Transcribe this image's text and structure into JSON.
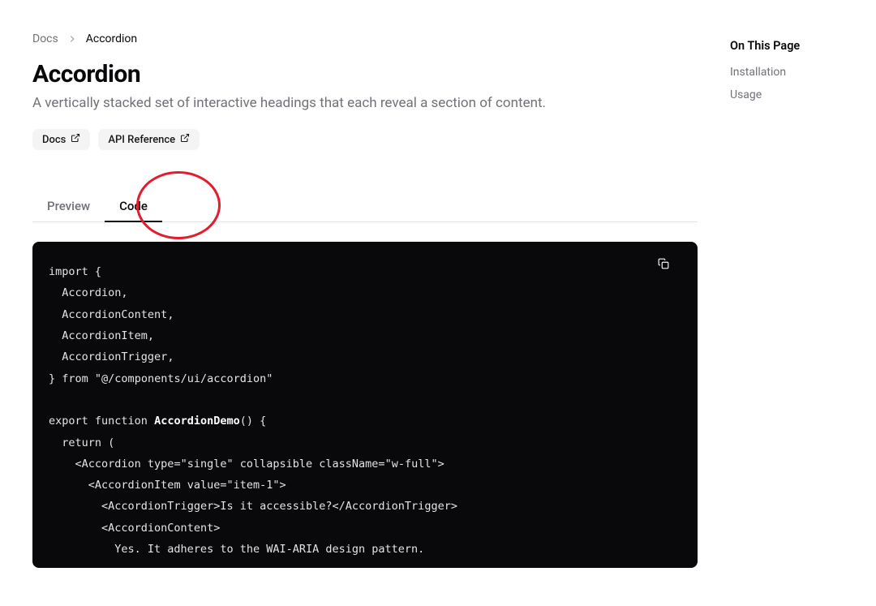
{
  "breadcrumb": {
    "docs": "Docs",
    "current": "Accordion"
  },
  "title": "Accordion",
  "description": "A vertically stacked set of interactive headings that each reveal a section of content.",
  "pills": {
    "docs": "Docs",
    "api": "API Reference"
  },
  "tabs": {
    "preview": "Preview",
    "code": "Code"
  },
  "code": {
    "line1_import": "import",
    "line1_brace": " {",
    "line2": "  Accordion",
    "line2_comma": ",",
    "line3": "  AccordionContent",
    "line3_comma": ",",
    "line4": "  AccordionItem",
    "line4_comma": ",",
    "line5": "  AccordionTrigger",
    "line5_comma": ",",
    "line6_brace": "}",
    "line6_from": " from ",
    "line6_str": "\"@/components/ui/accordion\"",
    "line7": "",
    "line8_export": "export",
    "line8_function": " function ",
    "line8_name": "AccordionDemo",
    "line8_rest": "() {",
    "line9": "  return (",
    "line10_a": "    <",
    "line10_b": "Accordion",
    "line10_c": " type",
    "line10_d": "=",
    "line10_e": "\"single\"",
    "line10_f": " collapsible className",
    "line10_g": "=",
    "line10_h": "\"w-full\"",
    "line10_i": ">",
    "line11_a": "      <",
    "line11_b": "AccordionItem",
    "line11_c": " value",
    "line11_d": "=",
    "line11_e": "\"item-1\"",
    "line11_f": ">",
    "line12_a": "        <",
    "line12_b": "AccordionTrigger",
    "line12_c": ">",
    "line12_d": "Is it accessible?",
    "line12_e": "</",
    "line12_f": "AccordionTrigger",
    "line12_g": ">",
    "line13_a": "        <",
    "line13_b": "AccordionContent",
    "line13_c": ">",
    "line14": "          Yes. It adheres to the WAI-ARIA design pattern."
  },
  "sidebar": {
    "title": "On This Page",
    "items": [
      "Installation",
      "Usage"
    ]
  }
}
